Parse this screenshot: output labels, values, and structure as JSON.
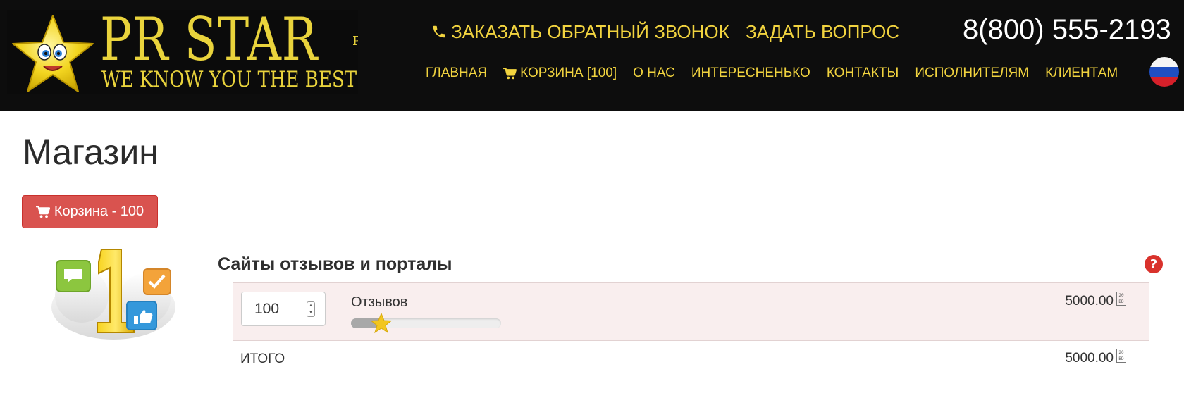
{
  "header": {
    "logo": {
      "title": "PR STAR",
      "tagline": "WE KNOW YOU THE BEST",
      "cut_text": "P"
    },
    "callback_label": "ЗАКАЗАТЬ ОБРАТНЫЙ ЗВОНОК",
    "ask_label": "ЗАДАТЬ ВОПРОС",
    "phone": "8(800) 555-2193",
    "nav": [
      {
        "label": "ГЛАВНАЯ"
      },
      {
        "label": "КОРЗИНА [100]",
        "icon": "cart-icon"
      },
      {
        "label": "О НАС"
      },
      {
        "label": "ИНТЕРЕСНЕНЬКО"
      },
      {
        "label": "КОНТАКТЫ"
      },
      {
        "label": "ИСПОЛНИТЕЛЯМ"
      },
      {
        "label": "КЛИЕНТАМ"
      }
    ],
    "language_flag": "russian-flag-icon"
  },
  "main": {
    "title": "Магазин",
    "cart_button_label": "Корзина - 100",
    "section": {
      "title": "Сайты отзывов и порталы",
      "item": {
        "quantity": "100",
        "label": "Отзывов",
        "price": "5000.00",
        "slider_fraction": 0.2
      },
      "total_label": "ИТОГО",
      "total_price": "5000.00"
    },
    "currency_icon": "ruble-placeholder-icon"
  },
  "colors": {
    "header_bg": "#0d0d0d",
    "accent_yellow": "#f1d33f",
    "cart_button": "#d9534f",
    "row_bg": "#f9eeee",
    "help_icon": "#d9322c"
  }
}
